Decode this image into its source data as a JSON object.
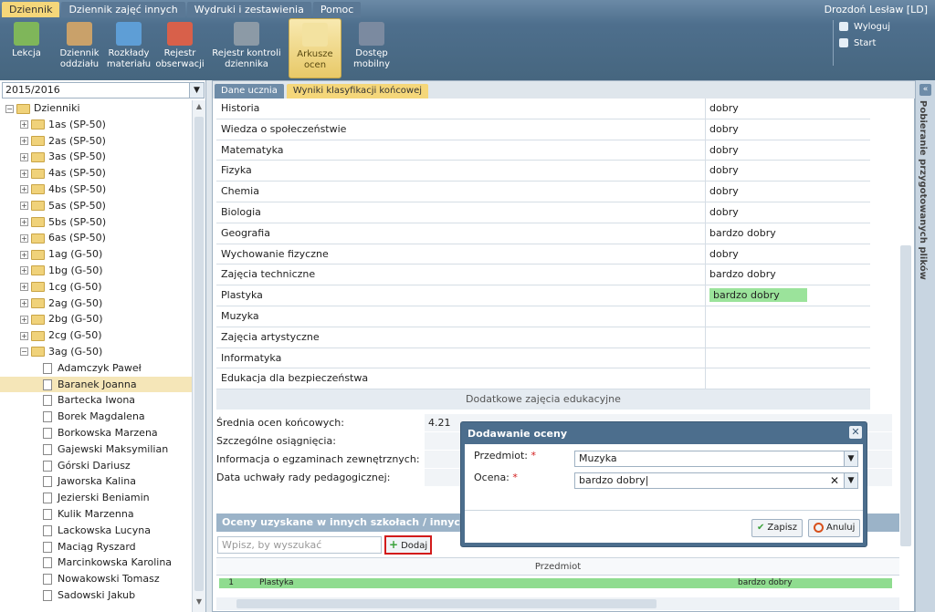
{
  "menu": {
    "tabs": [
      "Dziennik",
      "Dziennik zajęć innych",
      "Wydruki i zestawienia",
      "Pomoc"
    ],
    "user": "Drozdoń Lesław [LD]"
  },
  "toolbar": {
    "buttons": [
      {
        "label": "Lekcja",
        "icon": "lesson-icon"
      },
      {
        "label": "Dziennik\noddziału",
        "icon": "journal-icon"
      },
      {
        "label": "Rozkłady\nmateriału",
        "icon": "rm-icon"
      },
      {
        "label": "Rejestr\nobserwacji",
        "icon": "observation-icon"
      },
      {
        "label": "Rejestr kontroli\ndziennika",
        "icon": "control-icon"
      },
      {
        "label": "Arkusze\nocen",
        "icon": "grade-sheet-icon"
      },
      {
        "label": "Dostęp\nmobilny",
        "icon": "mobile-icon"
      }
    ],
    "logout": "Wyloguj",
    "start": "Start"
  },
  "left": {
    "year": "2015/2016",
    "root": "Dzienniki",
    "classes": [
      "1as (SP-50)",
      "2as (SP-50)",
      "3as (SP-50)",
      "4as (SP-50)",
      "4bs (SP-50)",
      "5as (SP-50)",
      "5bs (SP-50)",
      "6as (SP-50)",
      "1ag (G-50)",
      "1bg (G-50)",
      "1cg (G-50)",
      "2ag (G-50)",
      "2bg (G-50)",
      "2cg (G-50)",
      "3ag (G-50)"
    ],
    "students": [
      "Adamczyk Paweł",
      "Baranek Joanna",
      "Bartecka Iwona",
      "Borek Magdalena",
      "Borkowska Marzena",
      "Gajewski Maksymilian",
      "Górski Dariusz",
      "Jaworska Kalina",
      "Jezierski Beniamin",
      "Kulik Marzenna",
      "Lackowska Lucyna",
      "Maciąg Ryszard",
      "Marcinkowska Karolina",
      "Nowakowski Tomasz",
      "Sadowski Jakub"
    ]
  },
  "main": {
    "tabs": [
      "Dane ucznia",
      "Wyniki klasyfikacji końcowej"
    ],
    "grades": [
      [
        "Historia",
        "dobry"
      ],
      [
        "Wiedza o społeczeństwie",
        "dobry"
      ],
      [
        "Matematyka",
        "dobry"
      ],
      [
        "Fizyka",
        "dobry"
      ],
      [
        "Chemia",
        "dobry"
      ],
      [
        "Biologia",
        "dobry"
      ],
      [
        "Geografia",
        "bardzo dobry"
      ],
      [
        "Wychowanie fizyczne",
        "dobry"
      ],
      [
        "Zajęcia techniczne",
        "bardzo dobry"
      ],
      [
        "Plastyka",
        "bardzo dobry"
      ],
      [
        "Muzyka",
        ""
      ],
      [
        "Zajęcia artystyczne",
        ""
      ],
      [
        "Informatyka",
        ""
      ],
      [
        "Edukacja dla bezpieczeństwa",
        ""
      ]
    ],
    "extra": "Dodatkowe zajęcia edukacyjne",
    "info": [
      [
        "Średnia ocen końcowych:",
        "4.21"
      ],
      [
        "Szczególne osiągnięcia:",
        ""
      ],
      [
        "Informacja o egzaminach zewnętrznych:",
        ""
      ],
      [
        "Data uchwały rady pedagogicznej:",
        ""
      ]
    ],
    "other_title": "Oceny uzyskane w innych szkołach / innych oddziałach",
    "search_placeholder": "Wpisz, by wyszukać",
    "add": "Dodaj",
    "col_subject": "Przedmiot",
    "other_rows": [
      [
        "1",
        "Plastyka",
        "bardzo dobry"
      ]
    ]
  },
  "rightpanel": "Pobieranie przygotowanych plików",
  "dialog": {
    "title": "Dodawanie oceny",
    "subject_label": "Przedmiot:",
    "subject_value": "Muzyka",
    "grade_label": "Ocena:",
    "grade_value": "bardzo dobry",
    "save": "Zapisz",
    "cancel": "Anuluj"
  }
}
